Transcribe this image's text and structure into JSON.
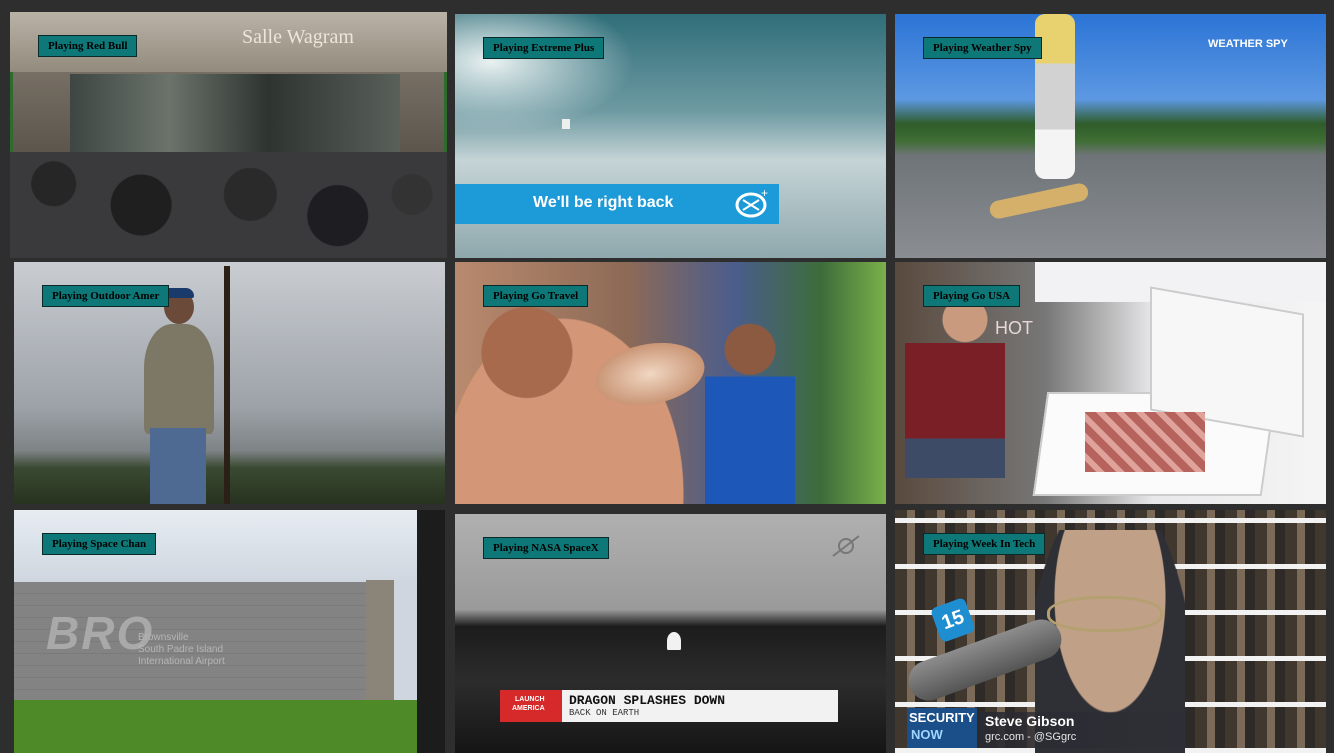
{
  "tiles": [
    {
      "label": "Playing Red Bull",
      "selected": true,
      "scene": {
        "building_sign": "Salle Wagram"
      }
    },
    {
      "label": "Playing Extreme Plus",
      "scene": {
        "banner_text": "We'll be right back",
        "logo_text": "e+"
      }
    },
    {
      "label": "Playing Weather Spy",
      "scene": {
        "watermark": "WEATHER SPY"
      }
    },
    {
      "label": "Playing Outdoor Amer"
    },
    {
      "label": "Playing Go Travel"
    },
    {
      "label": "Playing Go USA",
      "scene": {
        "shirt_text": "HOT"
      }
    },
    {
      "label": "Playing Space Chan",
      "scene": {
        "sign_letters": "BRO",
        "sign_line1": "Brownsville",
        "sign_line2": "South Padre Island",
        "sign_line3": "International Airport"
      }
    },
    {
      "label": "Playing NASA SpaceX",
      "scene": {
        "tag_line1": "LAUNCH",
        "tag_line2": "AMERICA",
        "headline": "DRAGON SPLASHES DOWN",
        "subhead": "BACK ON EARTH"
      }
    },
    {
      "label": "Playing Week In Tech",
      "scene": {
        "show_line1": "SECURITY",
        "show_line2": "NOW",
        "host_name": "Steve Gibson",
        "host_handle": "grc.com - @SGgrc",
        "mic_badge": "15"
      }
    }
  ],
  "colors": {
    "badge": "#0e7777",
    "selected_border": "#2f6b2a",
    "banner_blue": "#1d9ad8",
    "launch_red": "#d62a2a"
  }
}
